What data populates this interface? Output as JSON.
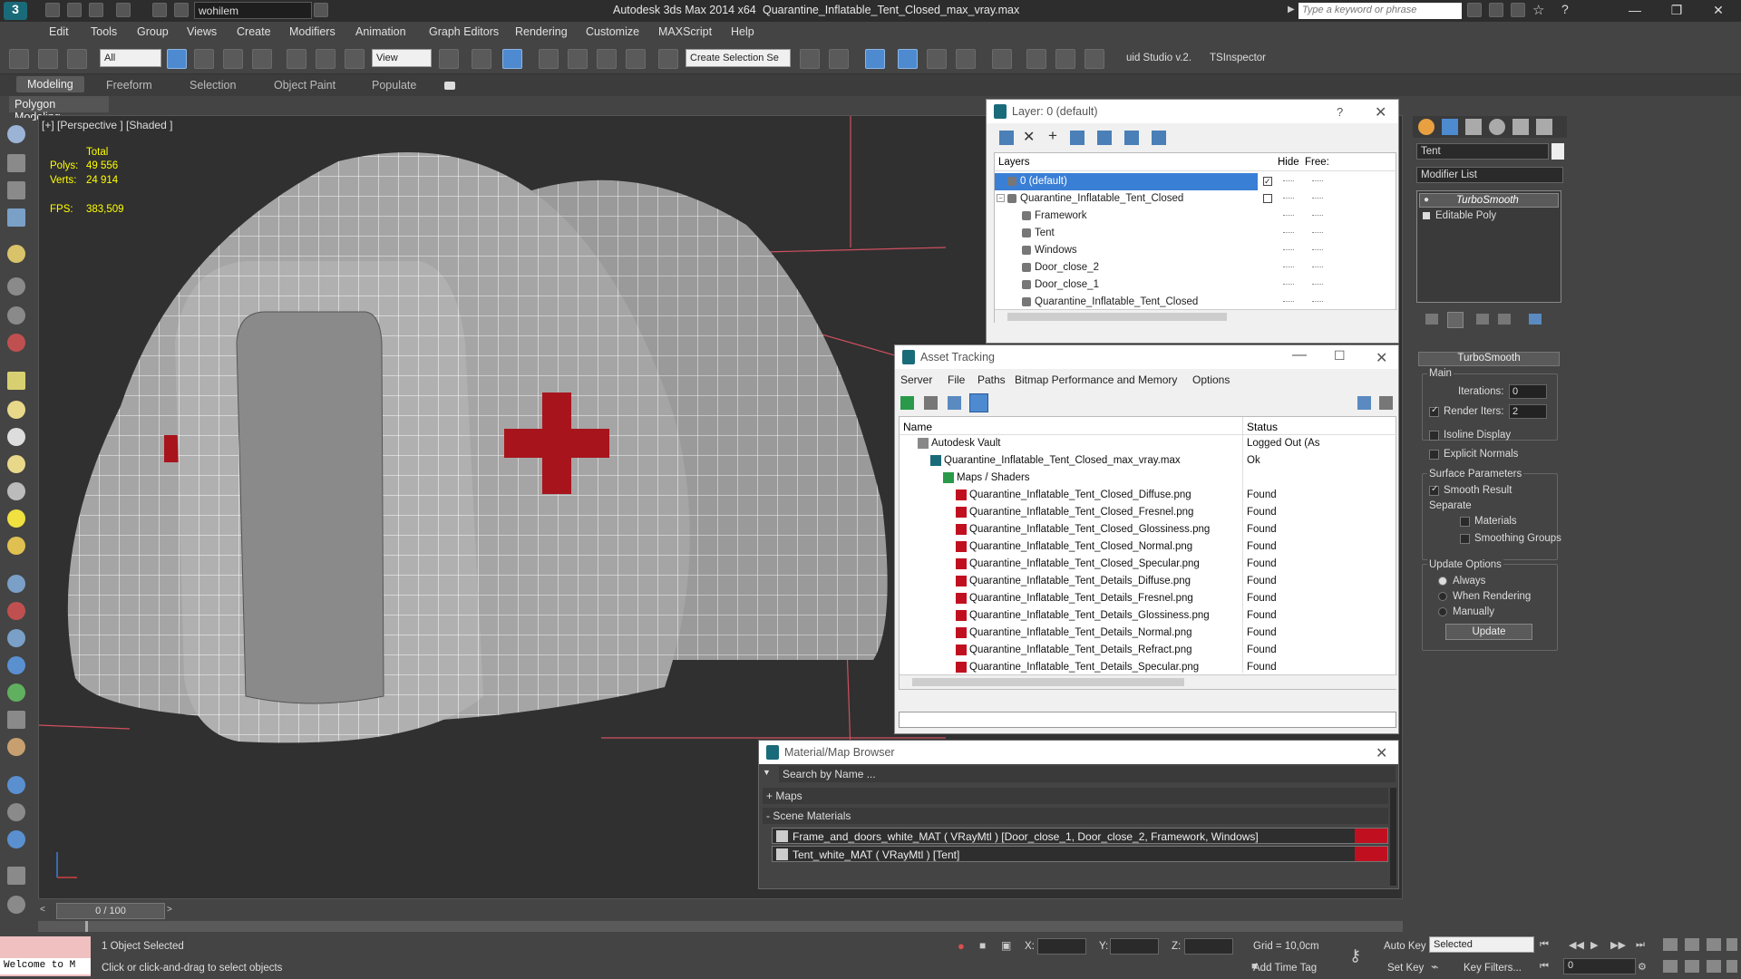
{
  "app": {
    "title": "Autodesk 3ds Max  2014 x64",
    "file": "Quarantine_Inflatable_Tent_Closed_max_vray.max",
    "workspace": "wohilem",
    "search_placeholder": "Type a keyword or phrase"
  },
  "menu": [
    "Edit",
    "Tools",
    "Group",
    "Views",
    "Create",
    "Modifiers",
    "Animation",
    "Graph Editors",
    "Rendering",
    "Customize",
    "MAXScript",
    "Help"
  ],
  "toolbar": {
    "filter": "All",
    "refcoord": "View",
    "selset": "Create Selection Se",
    "plugin1": "uid Studio v.2.",
    "plugin2": "TSInspector"
  },
  "ribbon": {
    "tabs": [
      "Modeling",
      "Freeform",
      "Selection",
      "Object Paint",
      "Populate"
    ],
    "active": "Modeling",
    "panel": "Polygon Modeling"
  },
  "viewport": {
    "label": "[+] [Perspective ] [Shaded ]",
    "stats": {
      "total_label": "Total",
      "polys_label": "Polys:",
      "polys": "49 556",
      "verts_label": "Verts:",
      "verts": "24 914",
      "fps_label": "FPS:",
      "fps": "383,509"
    }
  },
  "layer_panel": {
    "title": "Layer: 0 (default)",
    "help": "?",
    "cols": {
      "layers": "Layers",
      "hide": "Hide",
      "freeze": "Free:"
    },
    "rows": [
      {
        "name": "0 (default)",
        "indent": 0,
        "selected": true
      },
      {
        "name": "Quarantine_Inflatable_Tent_Closed",
        "indent": 0,
        "selected": false
      },
      {
        "name": "Framework",
        "indent": 1,
        "selected": false
      },
      {
        "name": "Tent",
        "indent": 1,
        "selected": false
      },
      {
        "name": "Windows",
        "indent": 1,
        "selected": false
      },
      {
        "name": "Door_close_2",
        "indent": 1,
        "selected": false
      },
      {
        "name": "Door_close_1",
        "indent": 1,
        "selected": false
      },
      {
        "name": "Quarantine_Inflatable_Tent_Closed",
        "indent": 1,
        "selected": false
      }
    ]
  },
  "asset_panel": {
    "title": "Asset Tracking",
    "menu": [
      "Server",
      "File",
      "Paths",
      "Bitmap Performance and Memory",
      "Options"
    ],
    "cols": {
      "name": "Name",
      "status": "Status"
    },
    "rows": [
      {
        "name": "Autodesk Vault",
        "status": "Logged Out (As",
        "level": 0,
        "type": "vault"
      },
      {
        "name": "Quarantine_Inflatable_Tent_Closed_max_vray.max",
        "status": "Ok",
        "level": 1,
        "type": "max"
      },
      {
        "name": "Maps / Shaders",
        "status": "",
        "level": 2,
        "type": "folder"
      },
      {
        "name": "Quarantine_Inflatable_Tent_Closed_Diffuse.png",
        "status": "Found",
        "level": 3,
        "type": "map"
      },
      {
        "name": "Quarantine_Inflatable_Tent_Closed_Fresnel.png",
        "status": "Found",
        "level": 3,
        "type": "map"
      },
      {
        "name": "Quarantine_Inflatable_Tent_Closed_Glossiness.png",
        "status": "Found",
        "level": 3,
        "type": "map"
      },
      {
        "name": "Quarantine_Inflatable_Tent_Closed_Normal.png",
        "status": "Found",
        "level": 3,
        "type": "map"
      },
      {
        "name": "Quarantine_Inflatable_Tent_Closed_Specular.png",
        "status": "Found",
        "level": 3,
        "type": "map"
      },
      {
        "name": "Quarantine_Inflatable_Tent_Details_Diffuse.png",
        "status": "Found",
        "level": 3,
        "type": "map"
      },
      {
        "name": "Quarantine_Inflatable_Tent_Details_Fresnel.png",
        "status": "Found",
        "level": 3,
        "type": "map"
      },
      {
        "name": "Quarantine_Inflatable_Tent_Details_Glossiness.png",
        "status": "Found",
        "level": 3,
        "type": "map"
      },
      {
        "name": "Quarantine_Inflatable_Tent_Details_Normal.png",
        "status": "Found",
        "level": 3,
        "type": "map"
      },
      {
        "name": "Quarantine_Inflatable_Tent_Details_Refract.png",
        "status": "Found",
        "level": 3,
        "type": "map"
      },
      {
        "name": "Quarantine_Inflatable_Tent_Details_Specular.png",
        "status": "Found",
        "level": 3,
        "type": "map"
      }
    ]
  },
  "material_panel": {
    "title": "Material/Map Browser",
    "search_placeholder": "Search by Name ...",
    "maps": "+ Maps",
    "scene": "- Scene Materials",
    "materials": [
      "Frame_and_doors_white_MAT  ( VRayMtl ) [Door_close_1, Door_close_2, Framework, Windows]",
      "Tent_white_MAT  ( VRayMtl ) [Tent]"
    ]
  },
  "command_panel": {
    "object_name": "Tent",
    "modifier_list": "Modifier List",
    "stack": [
      "TurboSmooth",
      "Editable Poly"
    ],
    "rollout": "TurboSmooth",
    "main": "Main",
    "iterations_label": "Iterations:",
    "iterations": "0",
    "render_iters_label": "Render Iters:",
    "render_iters": "2",
    "isoline": "Isoline Display",
    "explicit": "Explicit Normals",
    "surface": "Surface Parameters",
    "smooth_result": "Smooth Result",
    "separate": "Separate",
    "materials": "Materials",
    "smoothing_groups": "Smoothing Groups",
    "update_options": "Update Options",
    "always": "Always",
    "when_rendering": "When Rendering",
    "manually": "Manually",
    "update_btn": "Update"
  },
  "timeline": {
    "frame": "0 / 100"
  },
  "status": {
    "console": "Welcome to M",
    "selected": "1 Object Selected",
    "prompt": "Click or click-and-drag to select objects",
    "x": "X:",
    "y": "Y:",
    "z": "Z:",
    "grid": "Grid = 10,0cm",
    "add_time_tag": "Add Time Tag",
    "auto_key": "Auto Key",
    "set_key": "Set Key",
    "key_mode": "Selected",
    "key_filters": "Key Filters...",
    "frame_field": "0"
  }
}
